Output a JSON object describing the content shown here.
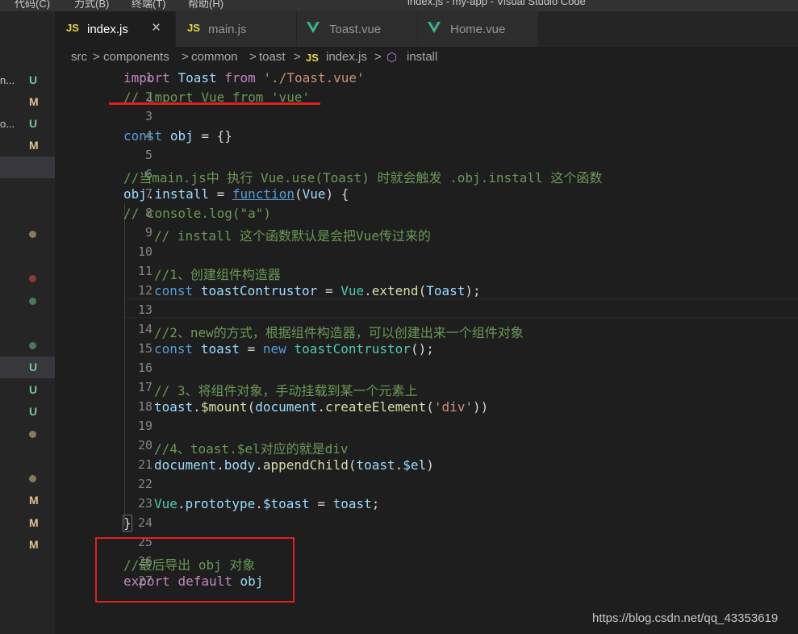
{
  "titlebar": {
    "fragments": [
      "代码(C)",
      "力式(B)",
      "终端(T)",
      "帮助(H)",
      "index.js - my-app - Visual Studio Code"
    ]
  },
  "tabs": [
    {
      "label": "index.js",
      "icon": "js-icon",
      "active": true
    },
    {
      "label": "main.js",
      "icon": "js-icon",
      "active": false
    },
    {
      "label": "Toast.vue",
      "icon": "vue-icon",
      "active": false
    },
    {
      "label": "Home.vue",
      "icon": "vue-icon",
      "active": false
    }
  ],
  "icons": {
    "js_label": "JS",
    "close": "×",
    "sep": ">",
    "install_icon": "⬡"
  },
  "breadcrumb": {
    "items": [
      "src",
      "components",
      "common",
      "toast",
      "index.js",
      "install"
    ]
  },
  "sidebar": {
    "rows": [
      {
        "name": "n...",
        "badge": "U"
      },
      {
        "name": "",
        "badge": "M"
      },
      {
        "name": "o...",
        "badge": "U"
      },
      {
        "name": "",
        "badge": "M"
      }
    ],
    "badges_lower": [
      "U",
      "U",
      "U",
      "M",
      "M",
      "M"
    ]
  },
  "line_numbers": [
    "1",
    "2",
    "3",
    "4",
    "5",
    "6",
    "7",
    "8",
    "9",
    "10",
    "11",
    "12",
    "13",
    "14",
    "15",
    "16",
    "17",
    "18",
    "19",
    "20",
    "21",
    "22",
    "23",
    "24",
    "25",
    "26",
    "27"
  ],
  "code": {
    "l1": [
      "import",
      " ",
      "Toast",
      " ",
      "from",
      " ",
      "'./Toast.vue'"
    ],
    "l2": "// import Vue from 'vue'",
    "l4": [
      "const",
      " ",
      "obj",
      " = {}"
    ],
    "l6": "//当main.js中 执行 Vue.use(Toast) 时就会触发 .obj.install 这个函数",
    "l7": [
      "obj",
      ".",
      "install",
      " = ",
      "function",
      "(",
      "Vue",
      ") {"
    ],
    "l8": "// console.log(\"a\")",
    "l9": "// install 这个函数默认是会把Vue传过来的",
    "l11": "//1、创建组件构造器",
    "l12": [
      "const",
      " ",
      "toastContrustor",
      " = ",
      "Vue",
      ".",
      "extend",
      "(",
      "Toast",
      ");"
    ],
    "l14": "//2、new的方式，根据组件构造器，可以创建出来一个组件对象",
    "l15": [
      "const",
      " ",
      "toast",
      " = ",
      "new",
      " ",
      "toastContrustor",
      "();"
    ],
    "l17": "// 3、将组件对象，手动挂载到某一个元素上",
    "l18": [
      "toast",
      ".",
      "$mount",
      "(",
      "document",
      ".",
      "createElement",
      "(",
      "'div'",
      "))"
    ],
    "l20": "//4、toast.$el对应的就是div",
    "l21": [
      "document",
      ".",
      "body",
      ".",
      "appendChild",
      "(",
      "toast",
      ".",
      "$el",
      ")"
    ],
    "l23": [
      "Vue",
      ".",
      "prototype",
      ".",
      "$toast",
      " = ",
      "toast",
      ";"
    ],
    "l24": "}",
    "l26": "//最后导出 obj 对象",
    "l27": [
      "export",
      " ",
      "default",
      " ",
      "obj"
    ]
  },
  "watermark": "https://blog.csdn.net/qq_43353619",
  "colors": {
    "annotation": "#e02020",
    "keyword": "#c586c0",
    "comment": "#6a9955"
  }
}
